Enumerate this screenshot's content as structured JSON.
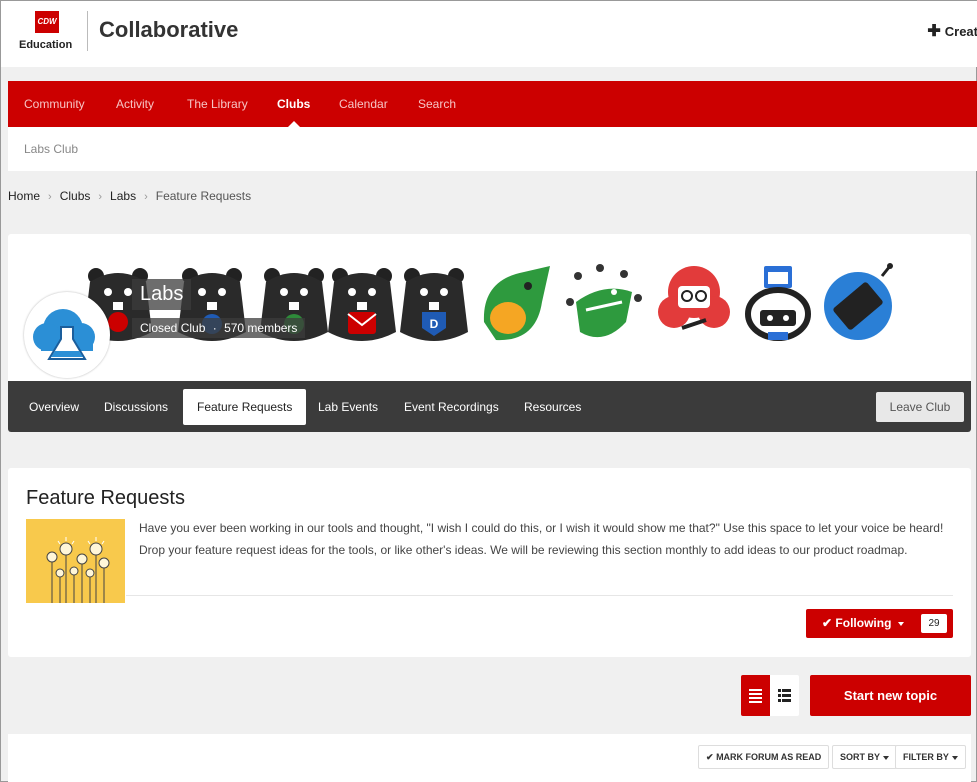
{
  "header": {
    "logo_badge": "CDW",
    "logo_text": "Education",
    "site_title": "Collaborative",
    "create_label": "Creat"
  },
  "nav": {
    "items": [
      "Community",
      "Activity",
      "The Library",
      "Clubs",
      "Calendar",
      "Search"
    ],
    "active": "Clubs",
    "subnav_label": "Labs Club"
  },
  "breadcrumb": [
    "Home",
    "Clubs",
    "Labs",
    "Feature Requests"
  ],
  "club": {
    "name": "Labs",
    "type": "Closed Club",
    "separator": "·",
    "members": "570 members",
    "tabs": [
      "Overview",
      "Discussions",
      "Feature Requests",
      "Lab Events",
      "Event Recordings",
      "Resources"
    ],
    "active_tab": "Feature Requests",
    "leave_label": "Leave Club"
  },
  "forum": {
    "title": "Feature Requests",
    "description": "Have you ever been working in our tools and thought, \"I wish I could do this, or I wish it would show me that?\" Use this space to let your voice be heard! Drop your feature request ideas for the tools, or like other's ideas. We will be reviewing this section monthly to add ideas to our product roadmap.",
    "following_label": "Following",
    "following_count": "29"
  },
  "actions": {
    "start_topic_label": "Start new topic",
    "mark_read_label": "MARK FORUM AS READ",
    "sort_label": "SORT BY",
    "filter_label": "FILTER BY"
  },
  "colors": {
    "brand_red": "#cc0000",
    "dark_bar": "#3b3b3b"
  }
}
